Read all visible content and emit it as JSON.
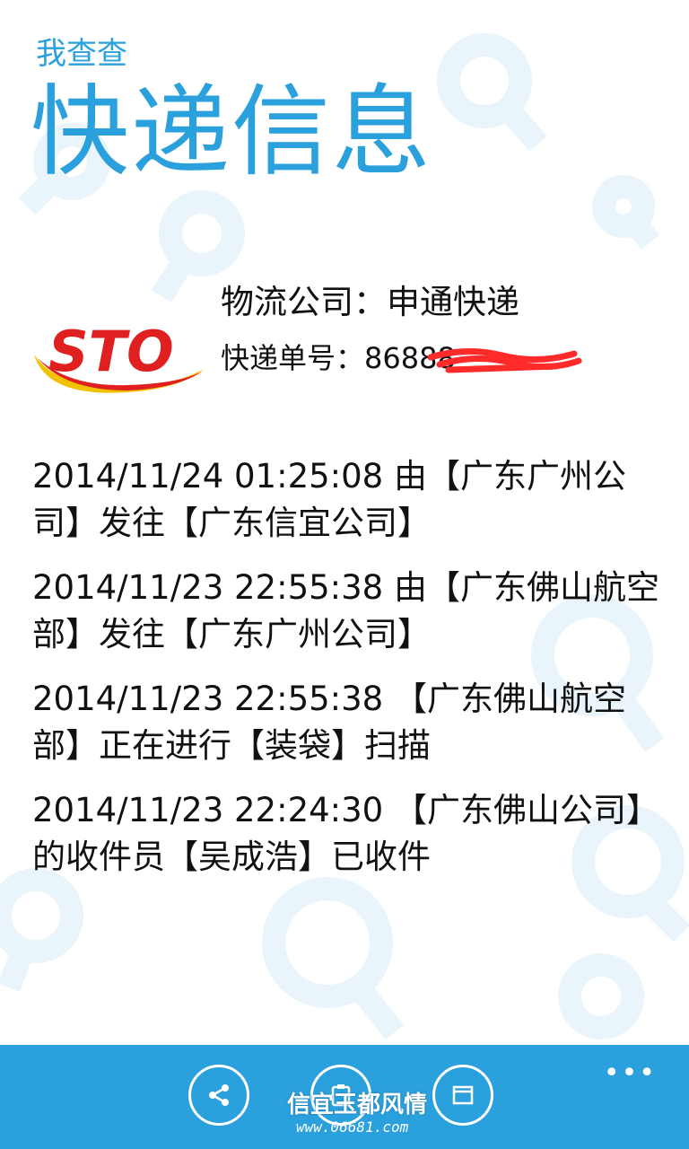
{
  "app": {
    "name": "我查查"
  },
  "page": {
    "title": "快递信息"
  },
  "shipment": {
    "logo_text": "STO",
    "company_label": "物流公司：",
    "company_value": "申通快递",
    "number_label": "快递单号：",
    "number_value": "86888"
  },
  "tracking": [
    {
      "text": "2014/11/24 01:25:08  由【广东广州公司】发往【广东信宜公司】"
    },
    {
      "text": "2014/11/23 22:55:38  由【广东佛山航空部】发往【广东广州公司】"
    },
    {
      "text": "2014/11/23 22:55:38  【广东佛山航空部】正在进行【装袋】扫描"
    },
    {
      "text": "2014/11/23 22:24:30  【广东佛山公司】的收件员【吴成浩】已收件"
    }
  ],
  "appbar": {
    "more_label": "•••",
    "buttons": [
      "share-icon",
      "clipboard-icon",
      "window-icon"
    ]
  },
  "watermark": {
    "title": "信宜玉都风情",
    "url": "www.06681.com"
  },
  "colors": {
    "accent": "#2aa0dc",
    "logo_red": "#e02020",
    "logo_yellow": "#f2c200",
    "redaction": "#ff2a2a"
  }
}
